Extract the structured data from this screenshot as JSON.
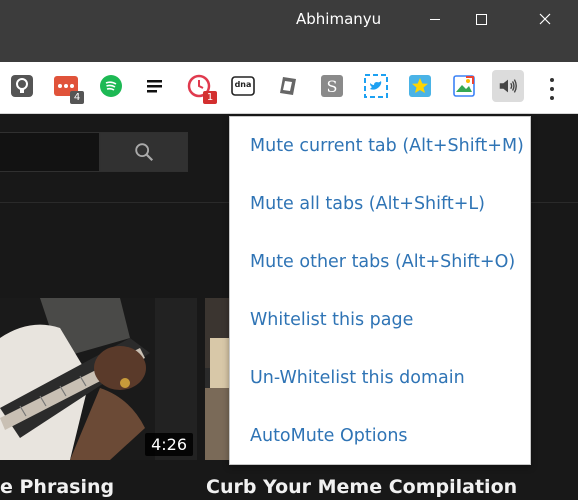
{
  "window": {
    "profile_name": "Abhimanyu",
    "controls": [
      "minimize",
      "maximize",
      "close"
    ]
  },
  "toolbar": {
    "extensions": [
      {
        "name": "bulb-extension-icon"
      },
      {
        "name": "tab-counter-extension-icon",
        "badge": "4"
      },
      {
        "name": "spotify-extension-icon"
      },
      {
        "name": "todoist-extension-icon"
      },
      {
        "name": "clock-extension-icon",
        "badge": "1"
      },
      {
        "name": "dna-extension-icon",
        "label": "dna"
      },
      {
        "name": "hexagon-extension-icon"
      },
      {
        "name": "s-extension-icon"
      },
      {
        "name": "twitter-extension-icon"
      },
      {
        "name": "star-extension-icon"
      },
      {
        "name": "image-extension-icon"
      },
      {
        "name": "automute-speaker-icon"
      }
    ],
    "menu_icon": "kebab-menu-icon"
  },
  "page": {
    "videos": [
      {
        "title": "e Phrasing",
        "duration": "4:26"
      },
      {
        "title": "Curb Your Meme Compilation"
      }
    ]
  },
  "automute_menu": {
    "items": [
      "Mute current tab (Alt+Shift+M)",
      "Mute all tabs (Alt+Shift+L)",
      "Mute other tabs (Alt+Shift+O)",
      "Whitelist this page",
      "Un-Whitelist this domain",
      "AutoMute Options"
    ]
  },
  "colors": {
    "menu_link": "#2f74b5",
    "titlebar": "#3c3c3c",
    "page_bg": "#181818"
  }
}
